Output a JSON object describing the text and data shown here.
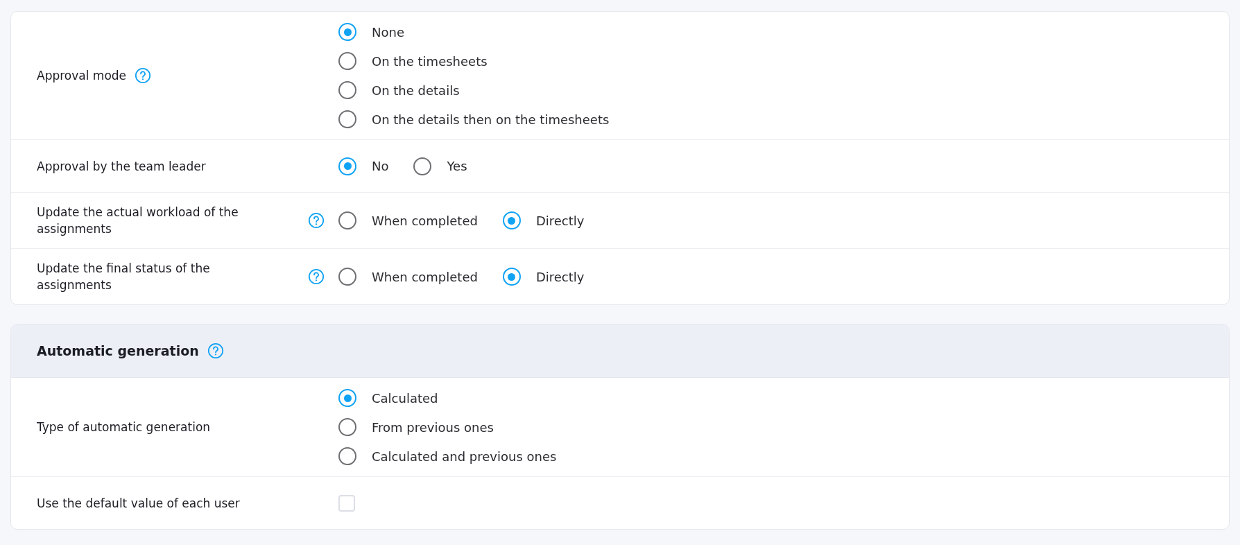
{
  "cards": [
    {
      "rows": [
        {
          "label": "Approval mode",
          "help": true,
          "kind": "radio-column",
          "options": [
            {
              "label": "None",
              "selected": true
            },
            {
              "label": "On the timesheets",
              "selected": false
            },
            {
              "label": "On the details",
              "selected": false
            },
            {
              "label": "On the details then on the timesheets",
              "selected": false
            }
          ]
        },
        {
          "label": "Approval by the team leader",
          "help": false,
          "kind": "radio-row",
          "options": [
            {
              "label": "No",
              "selected": true
            },
            {
              "label": "Yes",
              "selected": false
            }
          ]
        },
        {
          "label": "Update the actual workload of the assignments",
          "help": true,
          "kind": "radio-row",
          "options": [
            {
              "label": "When completed",
              "selected": false
            },
            {
              "label": "Directly",
              "selected": true
            }
          ]
        },
        {
          "label": "Update the final status of the assignments",
          "help": true,
          "kind": "radio-row",
          "options": [
            {
              "label": "When completed",
              "selected": false
            },
            {
              "label": "Directly",
              "selected": true
            }
          ]
        }
      ]
    },
    {
      "title": "Automatic generation",
      "title_help": true,
      "rows": [
        {
          "label": "Type of automatic generation",
          "help": false,
          "kind": "radio-column",
          "options": [
            {
              "label": "Calculated",
              "selected": true
            },
            {
              "label": "From previous ones",
              "selected": false
            },
            {
              "label": "Calculated and previous ones",
              "selected": false
            }
          ]
        },
        {
          "label": "Use the default value of each user",
          "help": false,
          "kind": "checkbox",
          "checked": false
        }
      ]
    }
  ]
}
